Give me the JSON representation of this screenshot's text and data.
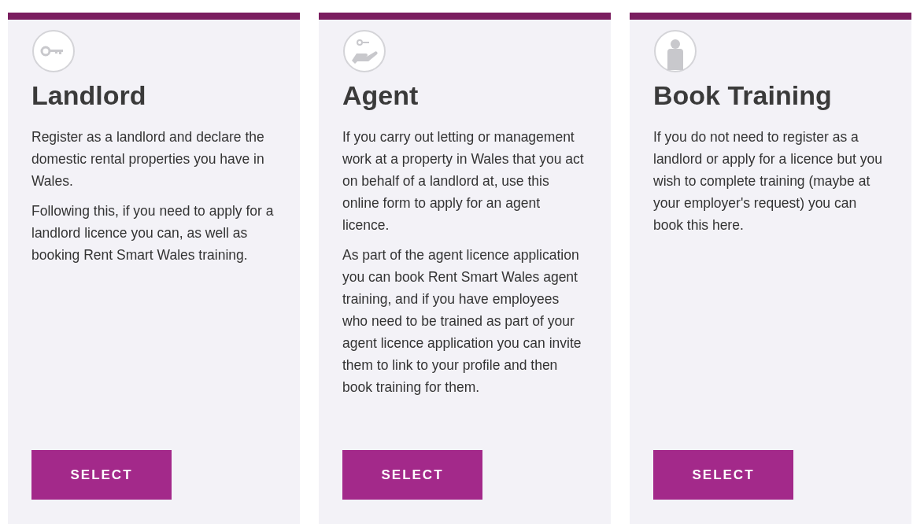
{
  "cards": [
    {
      "title": "Landlord",
      "paragraphs": [
        "Register as a landlord and declare the domestic rental properties you have in Wales.",
        "Following this, if you need to apply for a landlord licence you can, as well as booking Rent Smart Wales training."
      ],
      "button": "SELECT"
    },
    {
      "title": "Agent",
      "paragraphs": [
        "If you carry out letting or management work at a property in Wales that you act on behalf of a landlord at, use this online form to apply for an agent licence.",
        "As part of the agent licence application you can book Rent Smart Wales agent training, and if you have employees who need to be trained as part of your agent licence application you can invite them to link to your profile and then book training for them."
      ],
      "button": "SELECT"
    },
    {
      "title": "Book Training",
      "paragraphs": [
        "If you do not need to register as a landlord or apply for a licence but you wish to complete training (maybe at your employer's request) you can book this here."
      ],
      "button": "SELECT"
    }
  ]
}
